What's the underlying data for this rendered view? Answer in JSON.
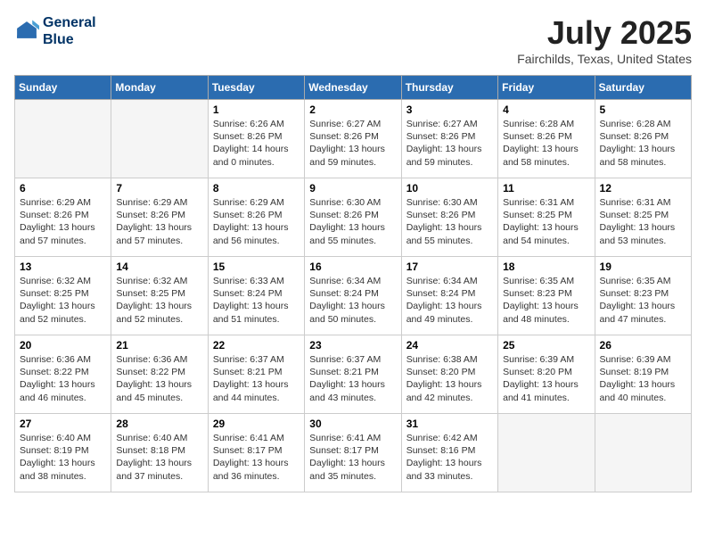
{
  "header": {
    "logo_line1": "General",
    "logo_line2": "Blue",
    "month_year": "July 2025",
    "location": "Fairchilds, Texas, United States"
  },
  "weekdays": [
    "Sunday",
    "Monday",
    "Tuesday",
    "Wednesday",
    "Thursday",
    "Friday",
    "Saturday"
  ],
  "weeks": [
    [
      {
        "day": "",
        "info": ""
      },
      {
        "day": "",
        "info": ""
      },
      {
        "day": "1",
        "info": "Sunrise: 6:26 AM\nSunset: 8:26 PM\nDaylight: 14 hours\nand 0 minutes."
      },
      {
        "day": "2",
        "info": "Sunrise: 6:27 AM\nSunset: 8:26 PM\nDaylight: 13 hours\nand 59 minutes."
      },
      {
        "day": "3",
        "info": "Sunrise: 6:27 AM\nSunset: 8:26 PM\nDaylight: 13 hours\nand 59 minutes."
      },
      {
        "day": "4",
        "info": "Sunrise: 6:28 AM\nSunset: 8:26 PM\nDaylight: 13 hours\nand 58 minutes."
      },
      {
        "day": "5",
        "info": "Sunrise: 6:28 AM\nSunset: 8:26 PM\nDaylight: 13 hours\nand 58 minutes."
      }
    ],
    [
      {
        "day": "6",
        "info": "Sunrise: 6:29 AM\nSunset: 8:26 PM\nDaylight: 13 hours\nand 57 minutes."
      },
      {
        "day": "7",
        "info": "Sunrise: 6:29 AM\nSunset: 8:26 PM\nDaylight: 13 hours\nand 57 minutes."
      },
      {
        "day": "8",
        "info": "Sunrise: 6:29 AM\nSunset: 8:26 PM\nDaylight: 13 hours\nand 56 minutes."
      },
      {
        "day": "9",
        "info": "Sunrise: 6:30 AM\nSunset: 8:26 PM\nDaylight: 13 hours\nand 55 minutes."
      },
      {
        "day": "10",
        "info": "Sunrise: 6:30 AM\nSunset: 8:26 PM\nDaylight: 13 hours\nand 55 minutes."
      },
      {
        "day": "11",
        "info": "Sunrise: 6:31 AM\nSunset: 8:25 PM\nDaylight: 13 hours\nand 54 minutes."
      },
      {
        "day": "12",
        "info": "Sunrise: 6:31 AM\nSunset: 8:25 PM\nDaylight: 13 hours\nand 53 minutes."
      }
    ],
    [
      {
        "day": "13",
        "info": "Sunrise: 6:32 AM\nSunset: 8:25 PM\nDaylight: 13 hours\nand 52 minutes."
      },
      {
        "day": "14",
        "info": "Sunrise: 6:32 AM\nSunset: 8:25 PM\nDaylight: 13 hours\nand 52 minutes."
      },
      {
        "day": "15",
        "info": "Sunrise: 6:33 AM\nSunset: 8:24 PM\nDaylight: 13 hours\nand 51 minutes."
      },
      {
        "day": "16",
        "info": "Sunrise: 6:34 AM\nSunset: 8:24 PM\nDaylight: 13 hours\nand 50 minutes."
      },
      {
        "day": "17",
        "info": "Sunrise: 6:34 AM\nSunset: 8:24 PM\nDaylight: 13 hours\nand 49 minutes."
      },
      {
        "day": "18",
        "info": "Sunrise: 6:35 AM\nSunset: 8:23 PM\nDaylight: 13 hours\nand 48 minutes."
      },
      {
        "day": "19",
        "info": "Sunrise: 6:35 AM\nSunset: 8:23 PM\nDaylight: 13 hours\nand 47 minutes."
      }
    ],
    [
      {
        "day": "20",
        "info": "Sunrise: 6:36 AM\nSunset: 8:22 PM\nDaylight: 13 hours\nand 46 minutes."
      },
      {
        "day": "21",
        "info": "Sunrise: 6:36 AM\nSunset: 8:22 PM\nDaylight: 13 hours\nand 45 minutes."
      },
      {
        "day": "22",
        "info": "Sunrise: 6:37 AM\nSunset: 8:21 PM\nDaylight: 13 hours\nand 44 minutes."
      },
      {
        "day": "23",
        "info": "Sunrise: 6:37 AM\nSunset: 8:21 PM\nDaylight: 13 hours\nand 43 minutes."
      },
      {
        "day": "24",
        "info": "Sunrise: 6:38 AM\nSunset: 8:20 PM\nDaylight: 13 hours\nand 42 minutes."
      },
      {
        "day": "25",
        "info": "Sunrise: 6:39 AM\nSunset: 8:20 PM\nDaylight: 13 hours\nand 41 minutes."
      },
      {
        "day": "26",
        "info": "Sunrise: 6:39 AM\nSunset: 8:19 PM\nDaylight: 13 hours\nand 40 minutes."
      }
    ],
    [
      {
        "day": "27",
        "info": "Sunrise: 6:40 AM\nSunset: 8:19 PM\nDaylight: 13 hours\nand 38 minutes."
      },
      {
        "day": "28",
        "info": "Sunrise: 6:40 AM\nSunset: 8:18 PM\nDaylight: 13 hours\nand 37 minutes."
      },
      {
        "day": "29",
        "info": "Sunrise: 6:41 AM\nSunset: 8:17 PM\nDaylight: 13 hours\nand 36 minutes."
      },
      {
        "day": "30",
        "info": "Sunrise: 6:41 AM\nSunset: 8:17 PM\nDaylight: 13 hours\nand 35 minutes."
      },
      {
        "day": "31",
        "info": "Sunrise: 6:42 AM\nSunset: 8:16 PM\nDaylight: 13 hours\nand 33 minutes."
      },
      {
        "day": "",
        "info": ""
      },
      {
        "day": "",
        "info": ""
      }
    ]
  ]
}
